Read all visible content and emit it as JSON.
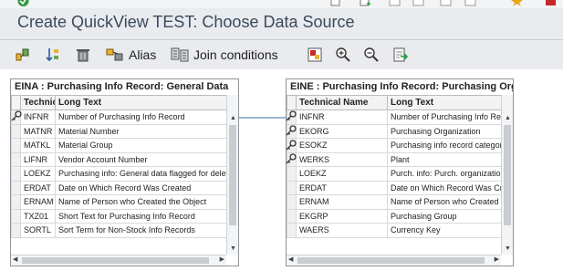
{
  "app": {
    "title": "Create QuickView TEST: Choose Data Source"
  },
  "toolbar": {
    "alias_label": "Alias",
    "join_conditions_label": "Join conditions"
  },
  "tables": {
    "left": {
      "title": "EINA : Purchasing Info Record: General Data",
      "col_technical": "Technical Name",
      "col_long": "Long Text",
      "rows": [
        {
          "name": "INFNR",
          "text": "Number of Purchasing Info Record"
        },
        {
          "name": "MATNR",
          "text": "Material Number"
        },
        {
          "name": "MATKL",
          "text": "Material Group"
        },
        {
          "name": "LIFNR",
          "text": "Vendor Account Number"
        },
        {
          "name": "LOEKZ",
          "text": "Purchasing info: General data flagged for deletion"
        },
        {
          "name": "ERDAT",
          "text": "Date on Which Record Was Created"
        },
        {
          "name": "ERNAM",
          "text": "Name of Person who Created the Object"
        },
        {
          "name": "TXZ01",
          "text": "Short Text for Purchasing Info Record"
        },
        {
          "name": "SORTL",
          "text": "Sort Term for Non-Stock Info Records"
        }
      ]
    },
    "right": {
      "title": "EINE : Purchasing Info Record: Purchasing Organization Data",
      "col_technical": "Technical Name",
      "col_long": "Long Text",
      "rows": [
        {
          "name": "INFNR",
          "text": "Number of Purchasing Info Record"
        },
        {
          "name": "EKORG",
          "text": "Purchasing Organization"
        },
        {
          "name": "ESOKZ",
          "text": "Purchasing info record category"
        },
        {
          "name": "WERKS",
          "text": "Plant"
        },
        {
          "name": "LOEKZ",
          "text": "Purch. info: Purch. organization data flagged for deletion"
        },
        {
          "name": "ERDAT",
          "text": "Date on Which Record Was Created"
        },
        {
          "name": "ERNAM",
          "text": "Name of Person who Created the Object"
        },
        {
          "name": "EKGRP",
          "text": "Purchasing Group"
        },
        {
          "name": "WAERS",
          "text": "Currency Key"
        }
      ]
    }
  },
  "colors": {
    "title": "#3a4a5c",
    "join_line": "#3a6ea5",
    "check_green": "#2e9a3c"
  }
}
